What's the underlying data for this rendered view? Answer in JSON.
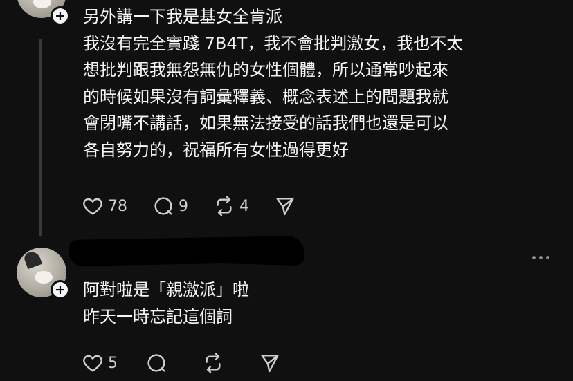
{
  "posts": [
    {
      "text": "另外講一下我是基女全肯派\n我沒有完全實踐 7B4T，我不會批判激女，我也不太\n想批判跟我無怨無仇的女性個體，所以通常吵起來\n的時候如果沒有詞彙釋義、概念表述上的問題我就\n會閉嘴不講話，如果無法接受的話我們也還是可以\n各自努力的，祝福所有女性過得更好",
      "likes": "78",
      "replies": "9",
      "reposts": "4"
    },
    {
      "text": "阿對啦是「親激派」啦\n昨天一時忘記這個詞",
      "likes": "5",
      "replies": "",
      "reposts": ""
    }
  ],
  "icons": {
    "like": "heart-icon",
    "reply": "comment-icon",
    "repost": "repost-icon",
    "share": "send-icon",
    "follow": "plus-icon",
    "more": "more-icon"
  }
}
